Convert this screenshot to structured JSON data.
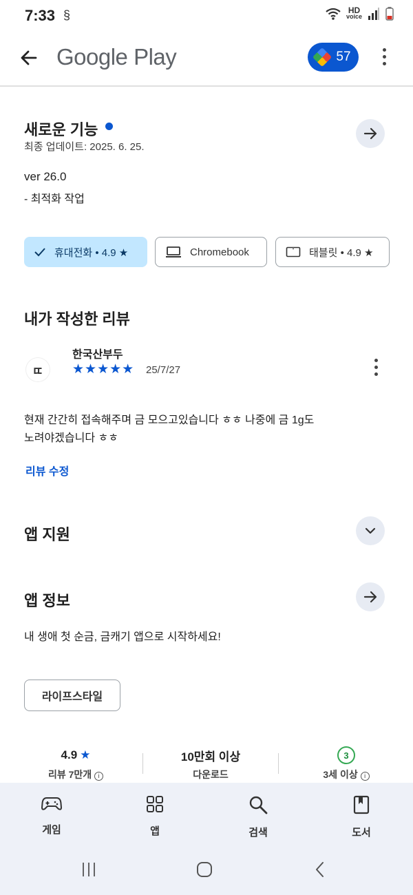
{
  "status_bar": {
    "time": "7:33",
    "extra_glyph": "§",
    "hd": "HD",
    "voice": "voice"
  },
  "header": {
    "title": "Google Play",
    "points": "57"
  },
  "whats_new": {
    "title": "새로운 기능",
    "updated": "최종 업데이트: 2025. 6. 25.",
    "version": "ver 26.0",
    "notes": "- 최적화 작업"
  },
  "device_chips": [
    {
      "label": "휴대전화 • 4.9 ★",
      "selected": true
    },
    {
      "label": "Chromebook",
      "selected": false
    },
    {
      "label": "태블릿 • 4.9 ★",
      "selected": false
    }
  ],
  "my_review": {
    "title": "내가 작성한 리뷰",
    "author": "한국산부두",
    "avatar_text": "ㄸ",
    "stars": "★★★★★",
    "date": "25/7/27",
    "text_line1": "현재 간간히 접속해주며 금 모으고있습니다 ㅎㅎ 나중에 금 1g도",
    "text_line2": "노려야겠습니다 ㅎㅎ",
    "edit_label": "리뷰 수정"
  },
  "app_support": {
    "title": "앱 지원"
  },
  "app_info": {
    "title": "앱 정보",
    "description": "내 생애 첫 순금, 금캐기 앱으로 시작하세요!",
    "category": "라이프스타일"
  },
  "stats": [
    {
      "value": "4.9",
      "label": "리뷰 7만개"
    },
    {
      "value": "10만회 이상",
      "label": "다운로드"
    },
    {
      "value": "3",
      "label": "3세 이상"
    }
  ],
  "bottom_nav": [
    {
      "label": "게임",
      "icon": "gamepad-icon"
    },
    {
      "label": "앱",
      "icon": "apps-grid-icon"
    },
    {
      "label": "검색",
      "icon": "search-icon"
    },
    {
      "label": "도서",
      "icon": "book-icon"
    }
  ],
  "colors": {
    "accent": "#0b57d0",
    "chip_selected": "#c2e7ff",
    "circle_button": "#e7ebf3",
    "nav_bg": "#eef1f8"
  }
}
